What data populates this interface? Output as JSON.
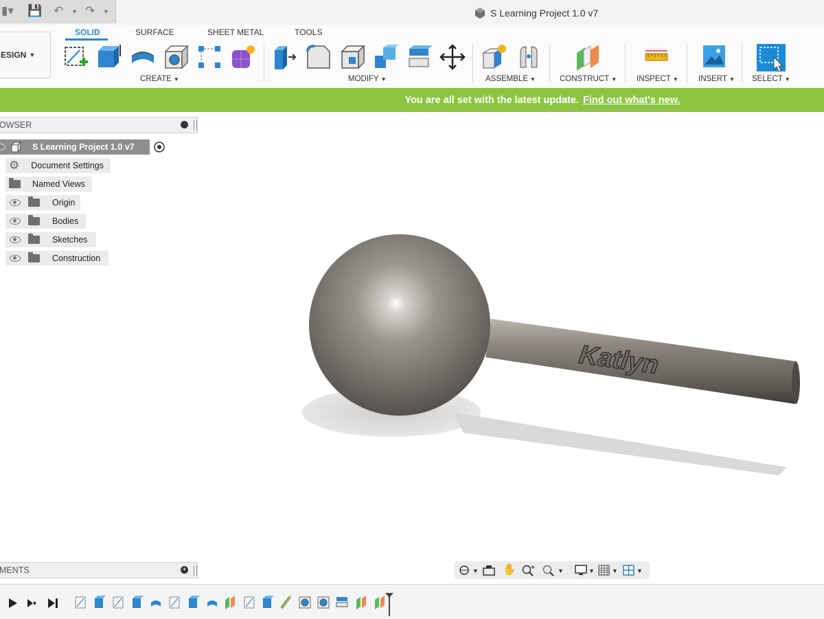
{
  "window": {
    "title": "S Learning Project 1.0 v7"
  },
  "workspace": {
    "label": "ESIGN"
  },
  "tabs": [
    {
      "label": "SOLID",
      "active": true
    },
    {
      "label": "SURFACE"
    },
    {
      "label": "SHEET METAL"
    },
    {
      "label": "TOOLS"
    }
  ],
  "groups": {
    "create": "CREATE",
    "modify": "MODIFY",
    "assemble": "ASSEMBLE",
    "construct": "CONSTRUCT",
    "inspect": "INSPECT",
    "insert": "INSERT",
    "select": "SELECT"
  },
  "banner": {
    "text": "You are all set with the latest update.",
    "link": "Find out what's new."
  },
  "browser": {
    "header": "OWSER",
    "root": "S Learning Project 1.0 v7",
    "items": [
      "Document Settings",
      "Named Views",
      "Origin",
      "Bodies",
      "Sketches",
      "Construction"
    ]
  },
  "comments": {
    "header": "MENTS"
  },
  "model": {
    "engraving": "Katlyn"
  },
  "colors": {
    "accent": "#1d8ad6",
    "banner": "#8cc540"
  }
}
